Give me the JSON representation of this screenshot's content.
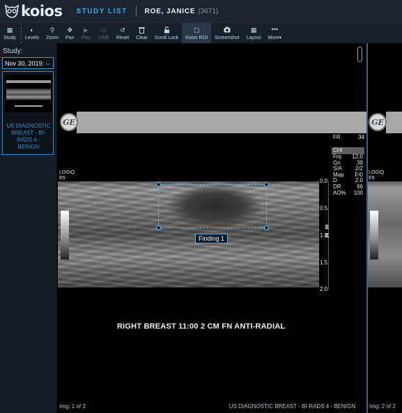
{
  "header": {
    "brand": "koios",
    "study_list": "STUDY LIST",
    "patient_name": "ROE, JANICE",
    "patient_id": "(3671)"
  },
  "toolbar": {
    "items": [
      {
        "label": "Study",
        "icon": "grid-icon",
        "glyph": "▦"
      },
      {
        "label": "Levels",
        "icon": "contrast-icon",
        "glyph": "◐"
      },
      {
        "label": "Zoom",
        "icon": "magnifier-icon",
        "glyph": "⚲"
      },
      {
        "label": "Pan",
        "icon": "move-icon",
        "glyph": "✥"
      },
      {
        "label": "Play",
        "icon": "play-icon",
        "glyph": "▶"
      },
      {
        "label": "CINE",
        "icon": "film-icon",
        "glyph": "▭"
      },
      {
        "label": "Reset",
        "icon": "undo-icon",
        "glyph": "↺"
      },
      {
        "label": "Clear",
        "icon": "trash-icon",
        "glyph": "🗑"
      },
      {
        "label": "Scroll Lock",
        "icon": "lock-icon",
        "glyph": "🔓"
      },
      {
        "label": "Koios ROI",
        "icon": "roi-square-icon",
        "glyph": "▢"
      },
      {
        "label": "Screenshot",
        "icon": "camera-icon",
        "glyph": "📷"
      },
      {
        "label": "Layout",
        "icon": "layout-icon",
        "glyph": "▦"
      },
      {
        "label": "More▾",
        "icon": "more-icon",
        "glyph": "•••"
      }
    ]
  },
  "sidebar": {
    "study_label": "Study:",
    "selected_date": "Nov 30, 2019:",
    "thumbnail_description": "US DIAGNOSTIC BREAST - BI-RADS 4 - BENIGN"
  },
  "viewer": {
    "fr_label": "FR",
    "fr_value": "34",
    "params_header": "CHI",
    "params": [
      {
        "k": "Frq",
        "v": "12.0"
      },
      {
        "k": "Gn",
        "v": "39"
      },
      {
        "k": "S/A",
        "v": "2/2"
      },
      {
        "k": "Map",
        "v": "F/0"
      },
      {
        "k": "D",
        "v": "2.0"
      },
      {
        "k": "DR",
        "v": "66"
      },
      {
        "k": "AO%",
        "v": "100"
      }
    ],
    "device_line1": "LOGIQ",
    "device_line2": "E9",
    "depth_ticks": [
      "0.0",
      "0.5",
      "1.0",
      "1.5",
      "2.0"
    ],
    "finding_label": "Finding 1",
    "caption": "RIGHT BREAST 11:00  2 CM FN ANTI-RADIAL",
    "img_counter": "Img: 1 of 2",
    "series_description": "US DIAGNOSTIC BREAST - BI-RADS 4 - BENIGN"
  },
  "viewer2": {
    "device_line1": "LOGIQ",
    "device_line2": "E9",
    "img_counter": "Img: 2 of 2"
  },
  "colors": {
    "accent": "#3fa6ef",
    "header_bg": "#1b2530",
    "toolbar_bg": "#162029",
    "roi_border": "#64b8ef"
  }
}
